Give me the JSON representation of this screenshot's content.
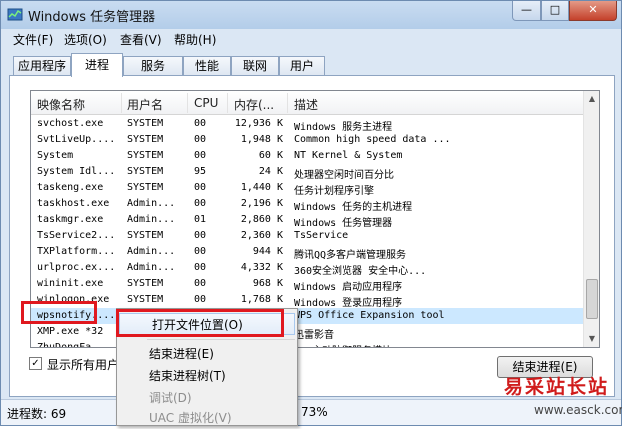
{
  "window": {
    "title": "Windows 任务管理器",
    "min": "—",
    "max": "□",
    "close": "✕"
  },
  "menu": [
    "文件(F)",
    "选项(O)",
    "查看(V)",
    "帮助(H)"
  ],
  "tabs": [
    "应用程序",
    "进程",
    "服务",
    "性能",
    "联网",
    "用户"
  ],
  "active_tab": "进程",
  "columns": [
    "映像名称",
    "用户名",
    "CPU",
    "内存(...",
    "描述"
  ],
  "rows": [
    [
      "svchost.exe",
      "SYSTEM",
      "00",
      "12,936 K",
      "Windows 服务主进程"
    ],
    [
      "SvtLiveUp....",
      "SYSTEM",
      "00",
      "1,948 K",
      "Common high speed data ..."
    ],
    [
      "System",
      "SYSTEM",
      "00",
      "60 K",
      "NT Kernel & System"
    ],
    [
      "System Idl...",
      "SYSTEM",
      "95",
      "24 K",
      "处理器空闲时间百分比"
    ],
    [
      "taskeng.exe",
      "SYSTEM",
      "00",
      "1,440 K",
      "任务计划程序引擎"
    ],
    [
      "taskhost.exe",
      "Admin...",
      "00",
      "2,196 K",
      "Windows 任务的主机进程"
    ],
    [
      "taskmgr.exe",
      "Admin...",
      "01",
      "2,860 K",
      "Windows 任务管理器"
    ],
    [
      "TsService2...",
      "SYSTEM",
      "00",
      "2,360 K",
      "TsService"
    ],
    [
      "TXPlatform...",
      "Admin...",
      "00",
      "944 K",
      "腾讯QQ多客户端管理服务"
    ],
    [
      "urlproc.ex...",
      "Admin...",
      "00",
      "4,332 K",
      "360安全浏览器 安全中心..."
    ],
    [
      "wininit.exe",
      "SYSTEM",
      "00",
      "968 K",
      "Windows 启动应用程序"
    ],
    [
      "winlogon.exe",
      "SYSTEM",
      "00",
      "1,768 K",
      "Windows 登录应用程序"
    ],
    [
      "wpsnotify....",
      "",
      "",
      "",
      "WPS Office Expansion tool"
    ],
    [
      "XMP.exe *32",
      "",
      "",
      "",
      "迅雷影音"
    ],
    [
      "ZhuDongFa...",
      "",
      "",
      "",
      "360主动防御服务模块"
    ]
  ],
  "context_menu": [
    {
      "label": "打开文件位置(O)",
      "disabled": false
    },
    {
      "label": "结束进程(E)",
      "disabled": false
    },
    {
      "label": "结束进程树(T)",
      "disabled": false
    },
    {
      "label": "调试(D)",
      "disabled": true
    },
    {
      "label": "UAC 虚拟化(V)",
      "disabled": true
    }
  ],
  "show_all_label": "显示所有用户",
  "end_process_label": "结束进程(E)",
  "status": {
    "processes": "进程数: 69",
    "memory": "73%"
  },
  "watermark": {
    "line1": "易采站长站",
    "line2": "www.easck.com"
  },
  "colors": {
    "highlight_red": "#e0181f",
    "selection": "#cce8ff"
  }
}
